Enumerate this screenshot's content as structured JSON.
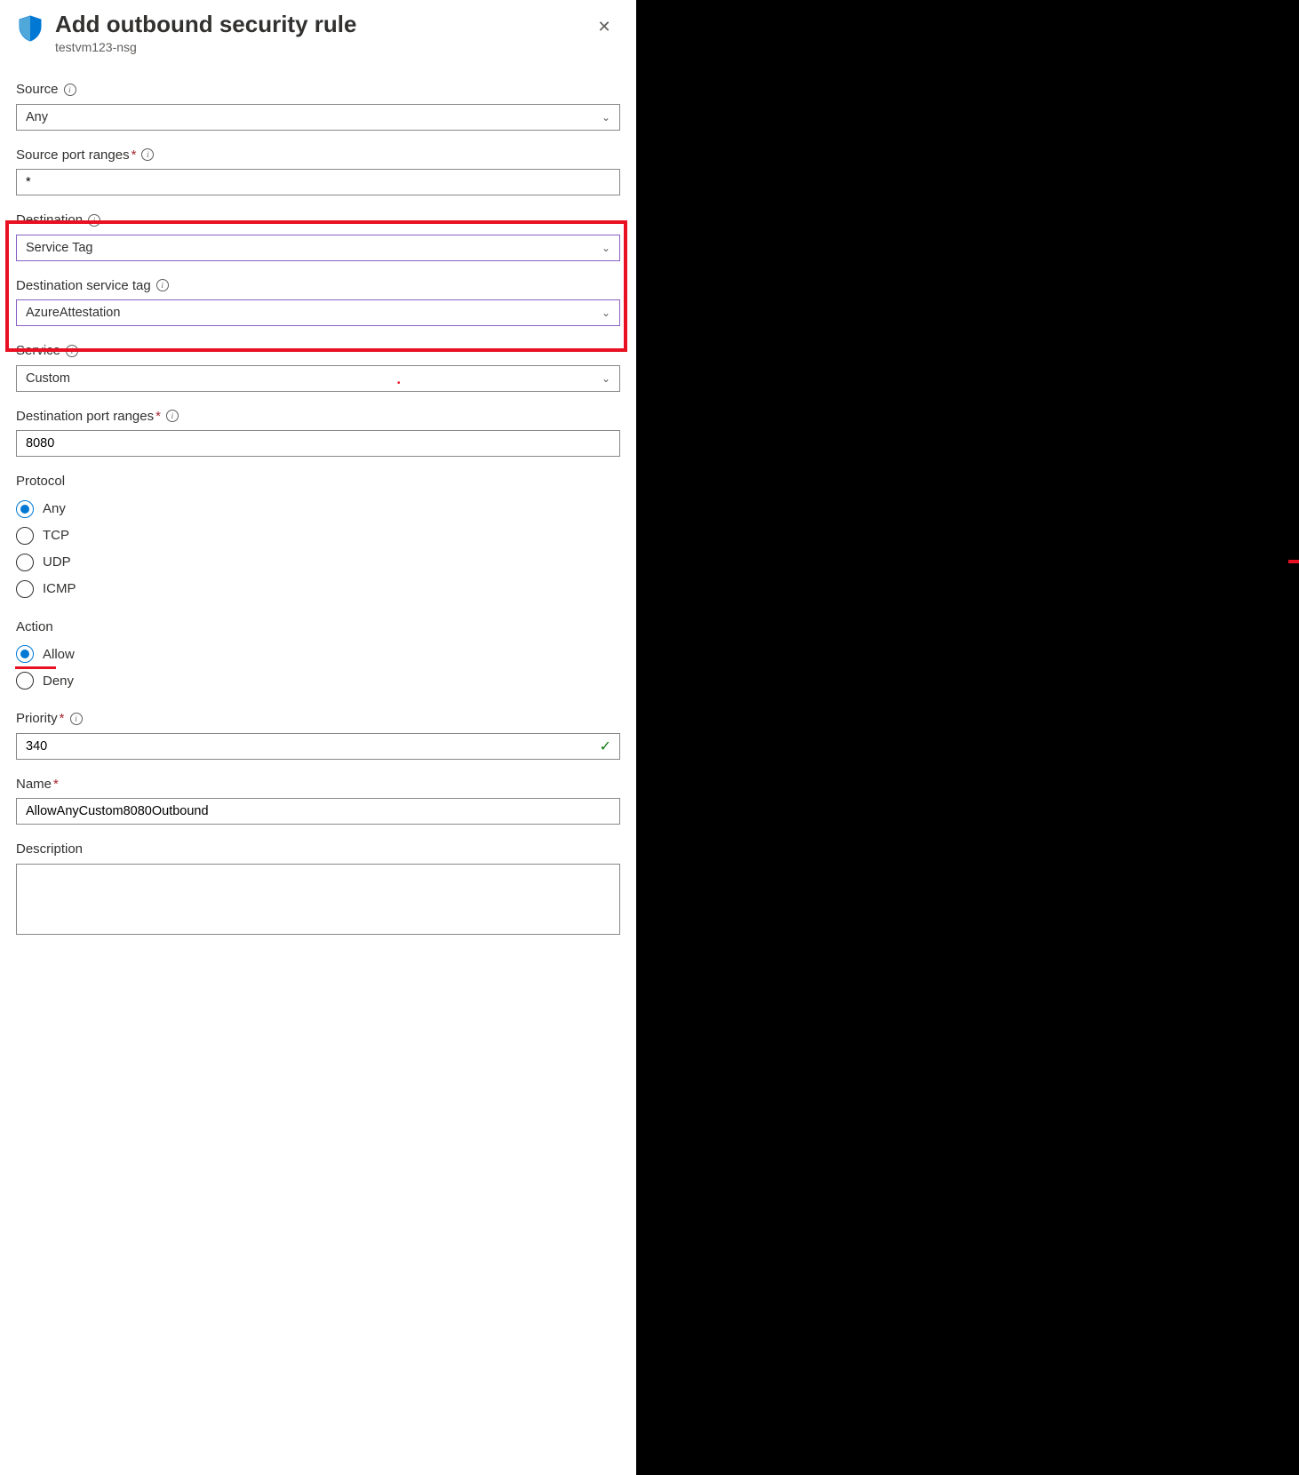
{
  "header": {
    "title": "Add outbound security rule",
    "subtitle": "testvm123-nsg"
  },
  "fields": {
    "source": {
      "label": "Source",
      "value": "Any"
    },
    "sourcePortRanges": {
      "label": "Source port ranges",
      "value": "*",
      "required": true
    },
    "destination": {
      "label": "Destination",
      "value": "Service Tag"
    },
    "destServiceTag": {
      "label": "Destination service tag",
      "value": "AzureAttestation"
    },
    "service": {
      "label": "Service",
      "value": "Custom"
    },
    "destPortRanges": {
      "label": "Destination port ranges",
      "value": "8080",
      "required": true
    },
    "protocol": {
      "label": "Protocol",
      "options": [
        "Any",
        "TCP",
        "UDP",
        "ICMP"
      ],
      "selected": "Any"
    },
    "action": {
      "label": "Action",
      "options": [
        "Allow",
        "Deny"
      ],
      "selected": "Allow"
    },
    "priority": {
      "label": "Priority",
      "value": "340",
      "required": true
    },
    "name": {
      "label": "Name",
      "value": "AllowAnyCustom8080Outbound",
      "required": true
    },
    "description": {
      "label": "Description",
      "value": ""
    }
  }
}
